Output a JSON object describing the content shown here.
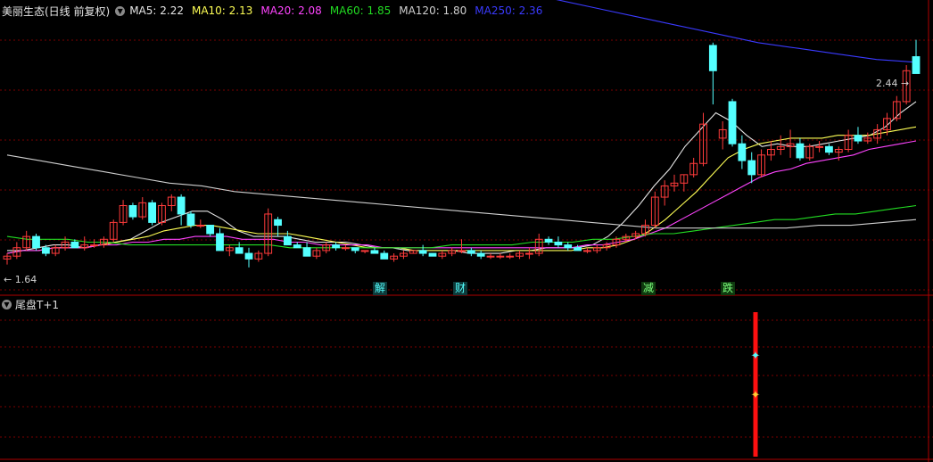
{
  "header": {
    "title": "美丽生态(日线 前复权)",
    "indicators": [
      {
        "label": "MA5: 2.22",
        "color": "#e6e6e6"
      },
      {
        "label": "MA10: 2.13",
        "color": "#ffff55"
      },
      {
        "label": "MA20: 2.08",
        "color": "#ff44ff"
      },
      {
        "label": "MA60: 1.85",
        "color": "#22dd22"
      },
      {
        "label": "MA120: 1.80",
        "color": "#cfcfcf"
      },
      {
        "label": "MA250: 2.36",
        "color": "#3a3aff"
      }
    ]
  },
  "sub_panel": {
    "title": "尾盘T+1"
  },
  "price_marks": {
    "high": "2.44",
    "low": "1.64"
  },
  "events": [
    "解",
    "财",
    "减",
    "跌"
  ],
  "colors": {
    "up": "#ff3b3b",
    "down": "#54ffff",
    "grid": "#7a0000",
    "ma5": "#e6e6e6",
    "ma10": "#ffff55",
    "ma20": "#ff44ff",
    "ma60": "#22dd22",
    "ma120": "#cfcfcf",
    "ma250": "#3a3aff",
    "signal": "#ff1010"
  },
  "chart_data": {
    "type": "candlestick",
    "ylim": [
      1.55,
      2.55
    ],
    "candles": [
      [
        1.66,
        1.68,
        1.64,
        1.67
      ],
      [
        1.67,
        1.72,
        1.66,
        1.7
      ],
      [
        1.7,
        1.76,
        1.69,
        1.74
      ],
      [
        1.74,
        1.75,
        1.69,
        1.7
      ],
      [
        1.7,
        1.71,
        1.67,
        1.68
      ],
      [
        1.68,
        1.71,
        1.67,
        1.7
      ],
      [
        1.7,
        1.74,
        1.69,
        1.72
      ],
      [
        1.72,
        1.73,
        1.7,
        1.7
      ],
      [
        1.7,
        1.74,
        1.69,
        1.71
      ],
      [
        1.71,
        1.73,
        1.7,
        1.71
      ],
      [
        1.71,
        1.74,
        1.7,
        1.73
      ],
      [
        1.73,
        1.8,
        1.72,
        1.79
      ],
      [
        1.79,
        1.87,
        1.78,
        1.85
      ],
      [
        1.85,
        1.86,
        1.8,
        1.81
      ],
      [
        1.81,
        1.88,
        1.8,
        1.86
      ],
      [
        1.86,
        1.87,
        1.78,
        1.79
      ],
      [
        1.79,
        1.86,
        1.78,
        1.85
      ],
      [
        1.85,
        1.89,
        1.83,
        1.88
      ],
      [
        1.88,
        1.89,
        1.78,
        1.82
      ],
      [
        1.82,
        1.83,
        1.77,
        1.78
      ],
      [
        1.78,
        1.8,
        1.77,
        1.78
      ],
      [
        1.78,
        1.76,
        1.74,
        1.75
      ],
      [
        1.75,
        1.77,
        1.69,
        1.69
      ],
      [
        1.69,
        1.71,
        1.67,
        1.7
      ],
      [
        1.7,
        1.72,
        1.68,
        1.68
      ],
      [
        1.68,
        1.7,
        1.63,
        1.66
      ],
      [
        1.66,
        1.69,
        1.65,
        1.68
      ],
      [
        1.68,
        1.84,
        1.67,
        1.82
      ],
      [
        1.8,
        1.81,
        1.74,
        1.78
      ],
      [
        1.74,
        1.76,
        1.71,
        1.71
      ],
      [
        1.71,
        1.72,
        1.7,
        1.7
      ],
      [
        1.7,
        1.72,
        1.67,
        1.67
      ],
      [
        1.67,
        1.7,
        1.66,
        1.69
      ],
      [
        1.69,
        1.72,
        1.68,
        1.71
      ],
      [
        1.71,
        1.72,
        1.69,
        1.7
      ],
      [
        1.7,
        1.71,
        1.69,
        1.7
      ],
      [
        1.7,
        1.7,
        1.68,
        1.69
      ],
      [
        1.69,
        1.69,
        1.68,
        1.69
      ],
      [
        1.69,
        1.7,
        1.68,
        1.68
      ],
      [
        1.68,
        1.69,
        1.66,
        1.66
      ],
      [
        1.66,
        1.68,
        1.65,
        1.67
      ],
      [
        1.67,
        1.69,
        1.66,
        1.68
      ],
      [
        1.68,
        1.69,
        1.68,
        1.69
      ],
      [
        1.69,
        1.71,
        1.67,
        1.68
      ],
      [
        1.68,
        1.68,
        1.67,
        1.67
      ],
      [
        1.67,
        1.69,
        1.66,
        1.68
      ],
      [
        1.68,
        1.7,
        1.67,
        1.69
      ],
      [
        1.69,
        1.73,
        1.68,
        1.69
      ],
      [
        1.69,
        1.7,
        1.67,
        1.68
      ],
      [
        1.68,
        1.69,
        1.66,
        1.67
      ],
      [
        1.67,
        1.68,
        1.66,
        1.67
      ],
      [
        1.67,
        1.68,
        1.66,
        1.67
      ],
      [
        1.67,
        1.68,
        1.66,
        1.67
      ],
      [
        1.67,
        1.69,
        1.66,
        1.68
      ],
      [
        1.68,
        1.7,
        1.66,
        1.68
      ],
      [
        1.68,
        1.75,
        1.67,
        1.73
      ],
      [
        1.73,
        1.74,
        1.71,
        1.72
      ],
      [
        1.72,
        1.74,
        1.7,
        1.71
      ],
      [
        1.71,
        1.72,
        1.69,
        1.7
      ],
      [
        1.7,
        1.71,
        1.69,
        1.69
      ],
      [
        1.69,
        1.7,
        1.68,
        1.69
      ],
      [
        1.69,
        1.71,
        1.68,
        1.7
      ],
      [
        1.7,
        1.72,
        1.69,
        1.71
      ],
      [
        1.71,
        1.74,
        1.7,
        1.73
      ],
      [
        1.73,
        1.75,
        1.72,
        1.74
      ],
      [
        1.74,
        1.76,
        1.73,
        1.75
      ],
      [
        1.75,
        1.8,
        1.74,
        1.78
      ],
      [
        1.78,
        1.9,
        1.77,
        1.88
      ],
      [
        1.88,
        1.94,
        1.85,
        1.92
      ],
      [
        1.92,
        1.96,
        1.9,
        1.93
      ],
      [
        1.93,
        1.96,
        1.9,
        1.96
      ],
      [
        1.96,
        2.02,
        1.95,
        2.0
      ],
      [
        2.0,
        2.18,
        1.99,
        2.14
      ],
      [
        2.42,
        2.43,
        2.21,
        2.33
      ],
      [
        2.09,
        2.15,
        2.05,
        2.12
      ],
      [
        2.22,
        2.23,
        2.06,
        2.07
      ],
      [
        2.07,
        2.1,
        1.98,
        2.01
      ],
      [
        2.01,
        2.04,
        1.93,
        1.96
      ],
      [
        1.96,
        2.05,
        1.95,
        2.03
      ],
      [
        2.03,
        2.08,
        2.01,
        2.05
      ],
      [
        2.05,
        2.1,
        2.03,
        2.06
      ],
      [
        2.06,
        2.12,
        2.02,
        2.07
      ],
      [
        2.07,
        2.09,
        2.01,
        2.02
      ],
      [
        2.02,
        2.07,
        2.01,
        2.06
      ],
      [
        2.06,
        2.08,
        2.04,
        2.06
      ],
      [
        2.06,
        2.07,
        2.03,
        2.04
      ],
      [
        2.04,
        2.06,
        2.01,
        2.05
      ],
      [
        2.05,
        2.12,
        2.04,
        2.1
      ],
      [
        2.1,
        2.13,
        2.07,
        2.08
      ],
      [
        2.08,
        2.11,
        2.07,
        2.09
      ],
      [
        2.09,
        2.14,
        2.07,
        2.12
      ],
      [
        2.12,
        2.18,
        2.1,
        2.16
      ],
      [
        2.16,
        2.24,
        2.15,
        2.22
      ],
      [
        2.22,
        2.35,
        2.21,
        2.33
      ],
      [
        2.38,
        2.44,
        2.37,
        2.32
      ]
    ],
    "ma_lines": [
      {
        "name": "MA5",
        "values": [
          1.69,
          1.69,
          1.7,
          1.71,
          1.71,
          1.7,
          1.71,
          1.72,
          1.73,
          1.76,
          1.79,
          1.81,
          1.83,
          1.83,
          1.8,
          1.76,
          1.74,
          1.74,
          1.74,
          1.73,
          1.72,
          1.72,
          1.72,
          1.71,
          1.7,
          1.7,
          1.69,
          1.69,
          1.69,
          1.69,
          1.68,
          1.68,
          1.68,
          1.69,
          1.69,
          1.7,
          1.7,
          1.7,
          1.71,
          1.74,
          1.79,
          1.85,
          1.92,
          1.98,
          2.06,
          2.12,
          2.18,
          2.15,
          2.1,
          2.06,
          2.07,
          2.06,
          2.06,
          2.07,
          2.08,
          2.09,
          2.1,
          2.13,
          2.18,
          2.22
        ]
      },
      {
        "name": "MA10",
        "values": [
          1.68,
          1.69,
          1.69,
          1.7,
          1.7,
          1.7,
          1.71,
          1.72,
          1.73,
          1.74,
          1.76,
          1.77,
          1.78,
          1.78,
          1.77,
          1.76,
          1.75,
          1.75,
          1.75,
          1.74,
          1.73,
          1.72,
          1.71,
          1.7,
          1.7,
          1.7,
          1.69,
          1.69,
          1.69,
          1.69,
          1.69,
          1.69,
          1.69,
          1.69,
          1.69,
          1.69,
          1.69,
          1.7,
          1.7,
          1.71,
          1.73,
          1.76,
          1.8,
          1.85,
          1.9,
          1.96,
          2.02,
          2.05,
          2.07,
          2.08,
          2.09,
          2.09,
          2.09,
          2.1,
          2.1,
          2.1,
          2.11,
          2.12,
          2.13
        ]
      },
      {
        "name": "MA20",
        "values": [
          1.68,
          1.69,
          1.69,
          1.7,
          1.7,
          1.7,
          1.71,
          1.71,
          1.72,
          1.72,
          1.73,
          1.73,
          1.74,
          1.74,
          1.74,
          1.73,
          1.73,
          1.73,
          1.72,
          1.72,
          1.71,
          1.71,
          1.71,
          1.71,
          1.7,
          1.7,
          1.7,
          1.7,
          1.7,
          1.7,
          1.7,
          1.7,
          1.7,
          1.7,
          1.7,
          1.7,
          1.7,
          1.71,
          1.71,
          1.72,
          1.73,
          1.75,
          1.77,
          1.8,
          1.83,
          1.86,
          1.89,
          1.92,
          1.95,
          1.97,
          1.98,
          2.0,
          2.01,
          2.02,
          2.03,
          2.05,
          2.06,
          2.07,
          2.08
        ]
      },
      {
        "name": "MA60",
        "values": [
          1.74,
          1.73,
          1.73,
          1.73,
          1.72,
          1.72,
          1.71,
          1.71,
          1.71,
          1.71,
          1.71,
          1.71,
          1.71,
          1.71,
          1.7,
          1.7,
          1.7,
          1.7,
          1.7,
          1.7,
          1.7,
          1.7,
          1.71,
          1.71,
          1.71,
          1.71,
          1.72,
          1.72,
          1.72,
          1.73,
          1.73,
          1.74,
          1.75,
          1.75,
          1.76,
          1.77,
          1.78,
          1.79,
          1.8,
          1.8,
          1.81,
          1.82,
          1.82,
          1.83,
          1.84,
          1.85
        ]
      },
      {
        "name": "MA120",
        "values": [
          2.03,
          2.01,
          1.99,
          1.97,
          1.95,
          1.93,
          1.92,
          1.9,
          1.89,
          1.88,
          1.87,
          1.86,
          1.85,
          1.84,
          1.83,
          1.82,
          1.81,
          1.8,
          1.79,
          1.78,
          1.77,
          1.77,
          1.77,
          1.77,
          1.77,
          1.78,
          1.78,
          1.79,
          1.8
        ]
      },
      {
        "name": "MA250",
        "values": [
          2.87,
          2.85,
          2.83,
          2.81,
          2.79,
          2.77,
          2.75,
          2.73,
          2.71,
          2.69,
          2.67,
          2.65,
          2.63,
          2.61,
          2.58,
          2.55,
          2.52,
          2.49,
          2.46,
          2.43,
          2.41,
          2.39,
          2.37,
          2.36
        ]
      }
    ]
  }
}
